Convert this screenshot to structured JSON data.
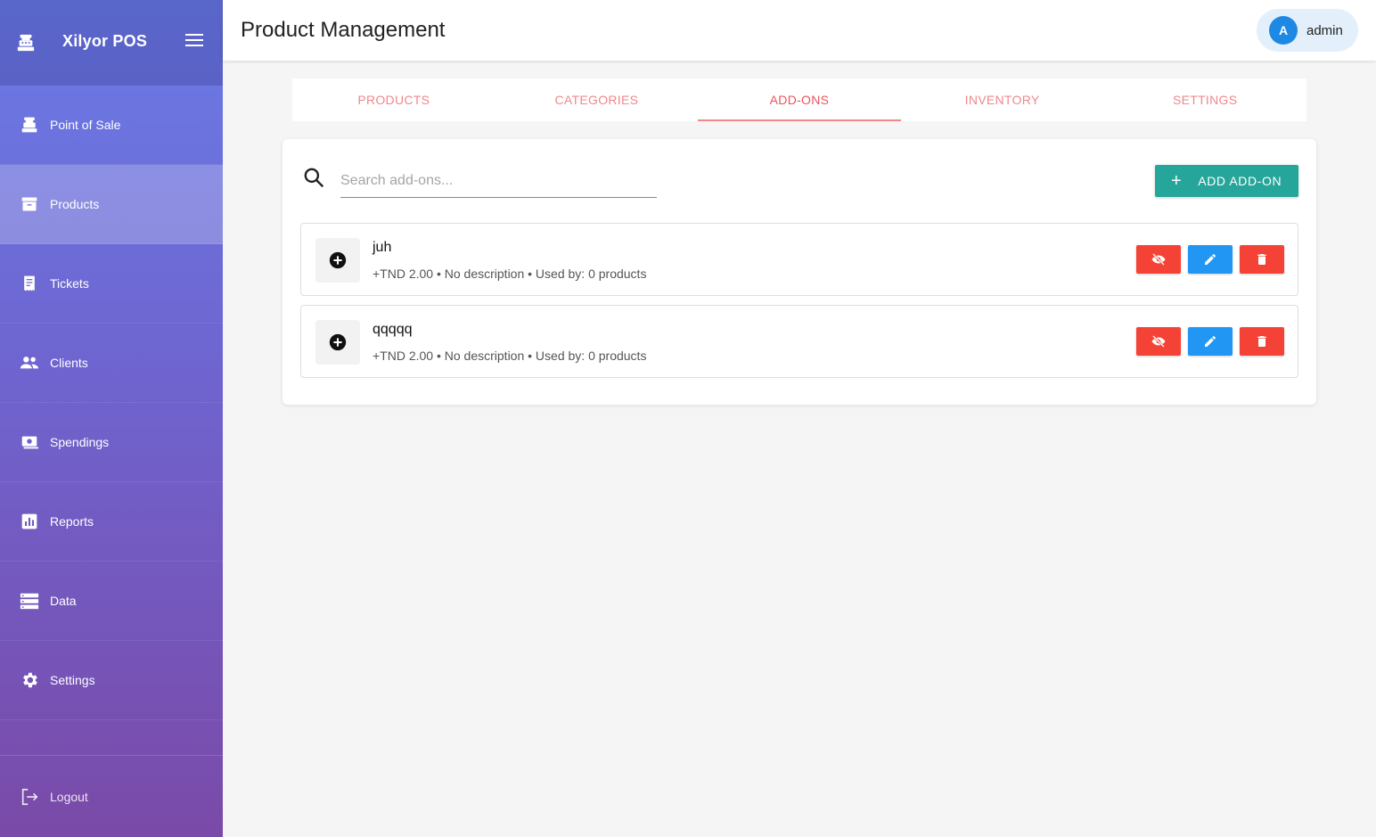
{
  "app": {
    "brand": "Xilyor POS"
  },
  "sidebar": {
    "items": [
      {
        "label": "Point of Sale",
        "icon": "cash-register-icon",
        "active": false
      },
      {
        "label": "Products",
        "icon": "archive-icon",
        "active": true
      },
      {
        "label": "Tickets",
        "icon": "receipt-icon",
        "active": false
      },
      {
        "label": "Clients",
        "icon": "people-icon",
        "active": false
      },
      {
        "label": "Spendings",
        "icon": "money-icon",
        "active": false
      },
      {
        "label": "Reports",
        "icon": "chart-icon",
        "active": false
      },
      {
        "label": "Data",
        "icon": "storage-icon",
        "active": false
      },
      {
        "label": "Settings",
        "icon": "gear-icon",
        "active": false
      }
    ],
    "logout_label": "Logout"
  },
  "header": {
    "title": "Product Management",
    "user": {
      "initial": "A",
      "name": "admin"
    }
  },
  "tabs": [
    {
      "label": "PRODUCTS",
      "active": false
    },
    {
      "label": "CATEGORIES",
      "active": false
    },
    {
      "label": "ADD-ONS",
      "active": true
    },
    {
      "label": "INVENTORY",
      "active": false
    },
    {
      "label": "SETTINGS",
      "active": false
    }
  ],
  "search": {
    "placeholder": "Search add-ons...",
    "value": ""
  },
  "add_button_label": "ADD ADD-ON",
  "addons": [
    {
      "name": "juh",
      "meta": "+TND 2.00 • No description • Used by: 0 products"
    },
    {
      "name": "qqqqq",
      "meta": "+TND 2.00 • No description • Used by: 0 products"
    }
  ],
  "colors": {
    "accent_tab": "#f0878c",
    "add_button": "#26a69a",
    "danger": "#f44336",
    "edit": "#2196f3",
    "avatar": "#1e88e5"
  }
}
